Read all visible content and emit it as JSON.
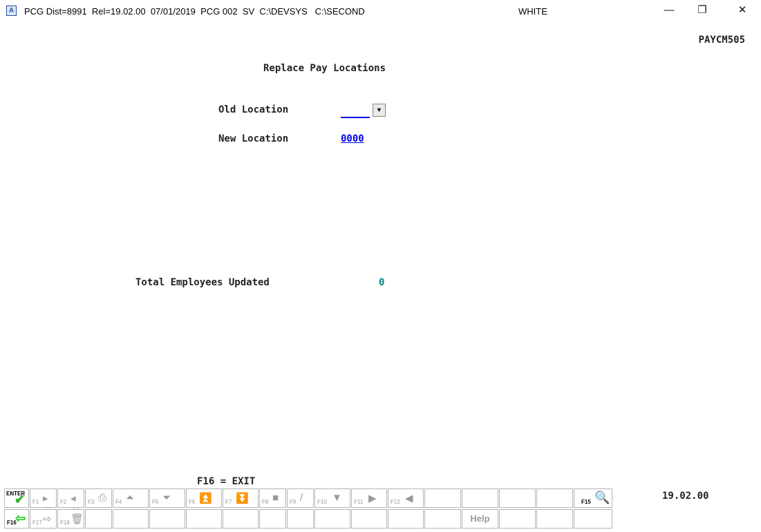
{
  "window": {
    "title": "PCG Dist=8991  Rel=19.02.00  07/01/2019  PCG 002  SV  C:\\DEVSYS   C:\\SECOND",
    "title_right": "WHITE",
    "minimize": "—",
    "restore": "❐",
    "close": "✕"
  },
  "screen": {
    "program_id": "PAYCM505",
    "title": "Replace Pay Locations",
    "old_location_label": "Old Location",
    "old_location_value": "",
    "new_location_label": "New Location",
    "new_location_value": "0000",
    "total_label": "Total Employees Updated",
    "total_value": "0",
    "exit_hint": "F16 = EXIT",
    "version": "19.02.00"
  },
  "toolbar": {
    "enter": "ENTER",
    "f1": "F1",
    "f2": "F2",
    "f3": "F3",
    "f4": "F4",
    "f5": "F5",
    "f6": "F6",
    "f7": "F7",
    "f8": "F8",
    "f9": "F9",
    "f10": "F10",
    "f11": "F11",
    "f12": "F12",
    "f15": "F15",
    "f16": "F16",
    "f17": "F17",
    "f18": "F18",
    "help": "Help"
  },
  "icons": {
    "enter": "check-icon",
    "f1": "next-person-icon",
    "f2": "prev-person-icon",
    "f3": "print-icon",
    "f4": "page-up-icon",
    "f5": "page-down-icon",
    "f6": "first-page-icon",
    "f7": "last-page-icon",
    "f8": "save-icon",
    "f9": "edit-icon",
    "f10": "filter-icon",
    "f11": "next-icon",
    "f12": "prev-icon",
    "f15": "search-icon",
    "f16": "exit-icon",
    "f17": "export-icon",
    "f18": "delete-icon"
  },
  "colors": {
    "link": "#0000ee",
    "total": "#008080",
    "enter_check": "#2bb02b",
    "f16_arrow": "#22c422"
  }
}
